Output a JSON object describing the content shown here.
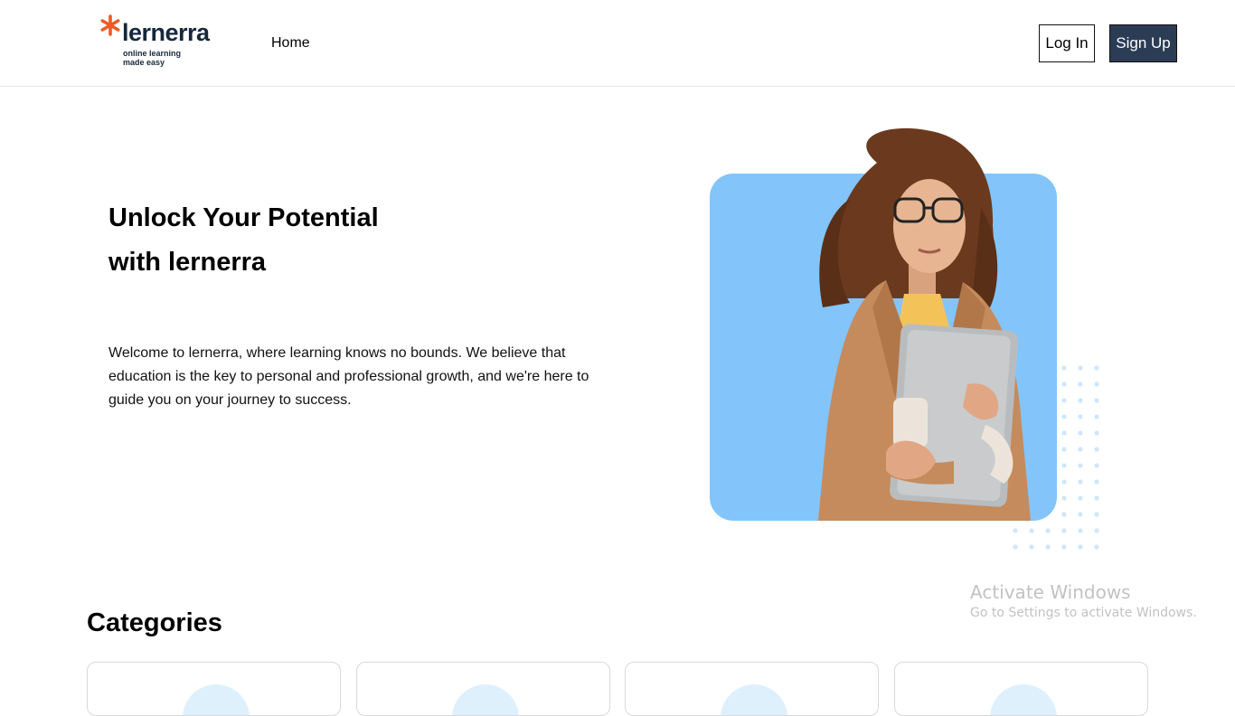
{
  "header": {
    "logo": {
      "name": "lernerra",
      "tagline": "online learning made easy",
      "accent_color": "#f05a22",
      "text_color": "#17283d"
    },
    "nav": {
      "home": "Home"
    },
    "auth": {
      "login": "Log In",
      "signup": "Sign Up"
    }
  },
  "hero": {
    "title": "Unlock Your Potential with lernerra",
    "description": "Welcome to lernerra, where learning knows no bounds. We believe that education is the key to personal and professional growth, and we're here to guide you on your journey to success.",
    "image_accent": "#83c5fb"
  },
  "categories": {
    "heading": "Categories",
    "cards": [
      {},
      {},
      {},
      {}
    ]
  },
  "os_watermark": {
    "line1": "Activate Windows",
    "line2": "Go to Settings to activate Windows."
  },
  "colors": {
    "signup_bg": "#2b3c55",
    "dot_color": "#cfe6fb"
  }
}
